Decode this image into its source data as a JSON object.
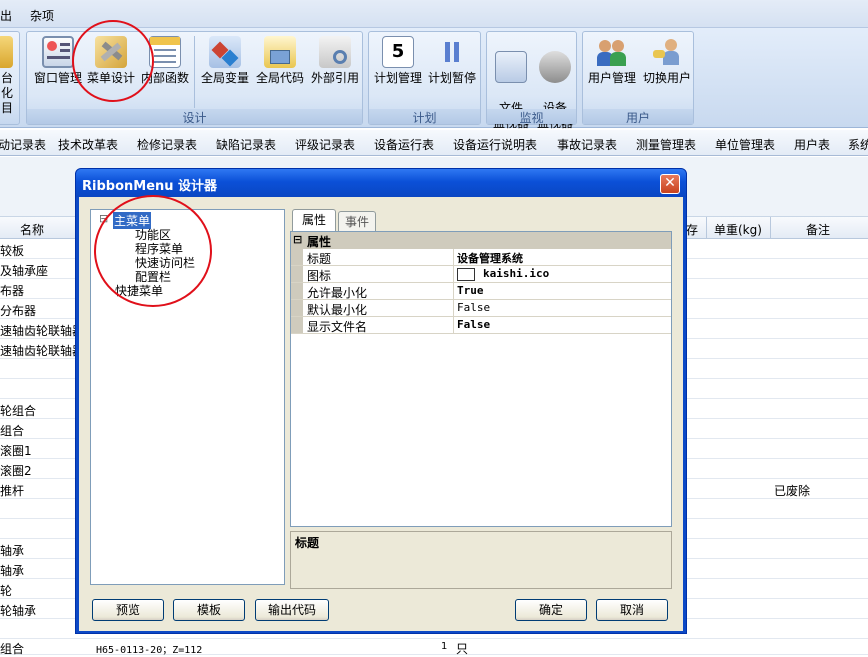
{
  "menubar": {
    "items": [
      "出",
      "杂项"
    ]
  },
  "ribbon": {
    "leftpartial": {
      "label_line1": "台化",
      "label_line2": "目"
    },
    "groups": [
      {
        "label": "设计",
        "buttons": [
          "窗口管理",
          "菜单设计",
          "内部函数",
          "全局变量",
          "全局代码",
          "外部引用"
        ]
      },
      {
        "label": "计划",
        "buttons": [
          "计划管理",
          "计划暂停"
        ]
      },
      {
        "label": "监视",
        "buttons": [
          "文件\n监视器",
          "设备\n监视器"
        ]
      },
      {
        "label": "用户",
        "buttons": [
          "用户管理",
          "切换用户"
        ]
      }
    ],
    "icons": [
      "window-manage-icon",
      "menu-design-icon",
      "internal-function-icon",
      "global-var-icon",
      "global-code-icon",
      "external-ref-icon",
      "plan-manage-icon",
      "plan-pause-icon",
      "file-monitor-icon",
      "device-monitor-icon",
      "user-manage-icon",
      "switch-user-icon"
    ]
  },
  "tabstrip": {
    "items": [
      "动记录表",
      "技术改革表",
      "检修记录表",
      "缺陷记录表",
      "评级记录表",
      "设备运行表",
      "设备运行说明表",
      "事故记录表",
      "测量管理表",
      "单位管理表",
      "用户表",
      "系统"
    ]
  },
  "grid": {
    "headers": {
      "name": "名称",
      "stock": "存",
      "unit_weight": "单重(kg)",
      "remark": "备注"
    },
    "rows": [
      {
        "name": "较板",
        "remark": ""
      },
      {
        "name": "及轴承座",
        "remark": ""
      },
      {
        "name": "布器",
        "remark": ""
      },
      {
        "name": "分布器",
        "remark": ""
      },
      {
        "name": "速轴齿轮联轴器",
        "remark": ""
      },
      {
        "name": "速轴齿轮联轴器",
        "remark": ""
      },
      {
        "name": "",
        "remark": ""
      },
      {
        "name": "",
        "remark": ""
      },
      {
        "name": "轮组合",
        "remark": ""
      },
      {
        "name": "组合",
        "remark": ""
      },
      {
        "name": "滚圈1",
        "remark": ""
      },
      {
        "name": "滚圈2",
        "remark": ""
      },
      {
        "name": "推杆",
        "remark": "已废除"
      },
      {
        "name": "",
        "remark": ""
      },
      {
        "name": "",
        "remark": ""
      },
      {
        "name": "轴承",
        "remark": ""
      },
      {
        "name": "轴承",
        "remark": ""
      },
      {
        "name": "轮",
        "remark": ""
      },
      {
        "name": "轮轴承",
        "remark": ""
      },
      {
        "name": "",
        "remark": ""
      }
    ],
    "bottom_row": {
      "name": "组合",
      "spec": "H65-0113-20；Z=112",
      "qty": "1",
      "unit": "只"
    }
  },
  "dialog": {
    "title": "RibbonMenu 设计器",
    "close_symbol": "✕",
    "tree": {
      "main": "主菜单",
      "children": [
        "功能区",
        "程序菜单",
        "快速访问栏",
        "配置栏"
      ],
      "quick": "快捷菜单",
      "expander": "⊟"
    },
    "tabs": {
      "properties": "属性",
      "events": "事件"
    },
    "propgrid": {
      "category": "属性",
      "category_toggle": "⊟",
      "rows": [
        {
          "name": "标题",
          "value": "设备管理系统",
          "bold": true
        },
        {
          "name": "图标",
          "value": "kaishi.ico",
          "bold": true,
          "swatch": true
        },
        {
          "name": "允许最小化",
          "value": "True",
          "bold": true
        },
        {
          "name": "默认最小化",
          "value": "False",
          "bold": false
        },
        {
          "name": "显示文件名",
          "value": "False",
          "bold": true
        }
      ]
    },
    "description_title": "标题",
    "buttons": {
      "preview": "预览",
      "template": "模板",
      "export": "输出代码",
      "ok": "确定",
      "cancel": "取消"
    }
  },
  "colors": {
    "annotation": "#e0101a",
    "title_bar": "#0b50d8",
    "selection": "#316ac5"
  }
}
